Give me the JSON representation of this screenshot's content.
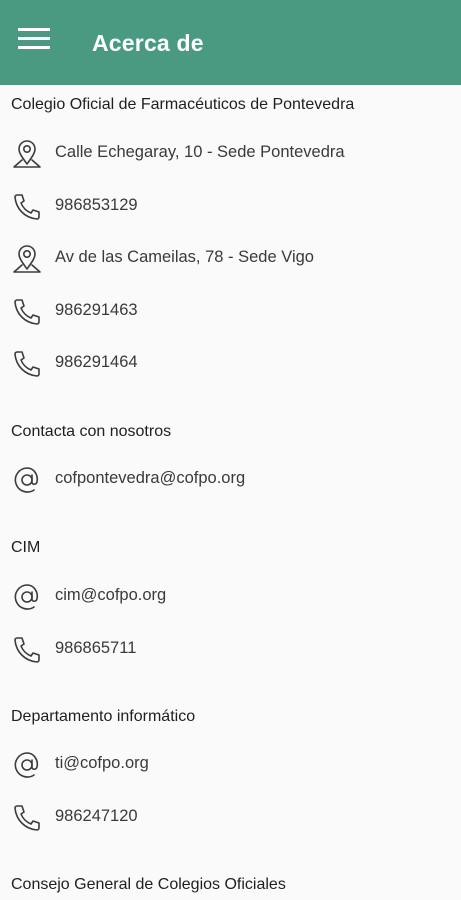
{
  "appbar": {
    "title": "Acerca de",
    "menu_icon": "hamburger-menu-icon",
    "color": "#4a9a82"
  },
  "sections": [
    {
      "title": "Colegio Oficial de Farmacéuticos de Pontevedra",
      "items": [
        {
          "icon": "location-pin-icon",
          "text": "Calle Echegaray, 10 - Sede Pontevedra"
        },
        {
          "icon": "phone-icon",
          "text": "986853129"
        },
        {
          "icon": "location-pin-icon",
          "text": "Av de las Cameilas, 78 - Sede Vigo"
        },
        {
          "icon": "phone-icon",
          "text": "986291463"
        },
        {
          "icon": "phone-icon",
          "text": "986291464"
        }
      ]
    },
    {
      "title": "Contacta con nosotros",
      "items": [
        {
          "icon": "at-sign-icon",
          "text": "cofpontevedra@cofpo.org"
        }
      ]
    },
    {
      "title": "CIM",
      "items": [
        {
          "icon": "at-sign-icon",
          "text": "cim@cofpo.org"
        },
        {
          "icon": "phone-icon",
          "text": "986865711"
        }
      ]
    },
    {
      "title": "Departamento informático",
      "items": [
        {
          "icon": "at-sign-icon",
          "text": "ti@cofpo.org"
        },
        {
          "icon": "phone-icon",
          "text": "986247120"
        }
      ]
    },
    {
      "title": "Consejo General de Colegios Oficiales",
      "items": []
    }
  ]
}
